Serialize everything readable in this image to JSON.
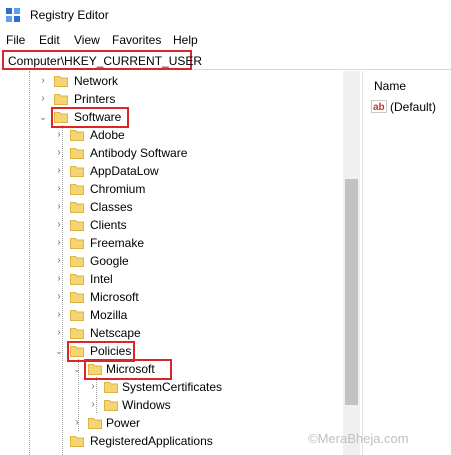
{
  "window": {
    "title": "Registry Editor"
  },
  "menu": [
    "File",
    "Edit",
    "View",
    "Favorites",
    "Help"
  ],
  "address": {
    "path": "Computer\\HKEY_CURRENT_USER"
  },
  "tree": {
    "items": [
      {
        "label": "Network",
        "toggle": "collapsed"
      },
      {
        "label": "Printers",
        "toggle": "collapsed"
      },
      {
        "label": "Software",
        "toggle": "expanded"
      },
      {
        "label": "Adobe",
        "toggle": "collapsed"
      },
      {
        "label": "Antibody Software",
        "toggle": "collapsed"
      },
      {
        "label": "AppDataLow",
        "toggle": "collapsed"
      },
      {
        "label": "Chromium",
        "toggle": "collapsed"
      },
      {
        "label": "Classes",
        "toggle": "collapsed"
      },
      {
        "label": "Clients",
        "toggle": "collapsed"
      },
      {
        "label": "Freemake",
        "toggle": "collapsed"
      },
      {
        "label": "Google",
        "toggle": "collapsed"
      },
      {
        "label": "Intel",
        "toggle": "collapsed"
      },
      {
        "label": "Microsoft",
        "toggle": "collapsed"
      },
      {
        "label": "Mozilla",
        "toggle": "collapsed"
      },
      {
        "label": "Netscape",
        "toggle": "collapsed"
      },
      {
        "label": "Policies",
        "toggle": "expanded"
      },
      {
        "label": "Microsoft",
        "toggle": "expanded",
        "selected": true
      },
      {
        "label": "SystemCertificates",
        "toggle": "collapsed"
      },
      {
        "label": "Windows",
        "toggle": "collapsed"
      },
      {
        "label": "Power",
        "toggle": "collapsed"
      },
      {
        "label": "RegisteredApplications",
        "toggle": "none"
      }
    ]
  },
  "values_pane": {
    "column_name": "Name",
    "rows": [
      {
        "name": "(Default)",
        "icon": "string-value-icon"
      }
    ]
  },
  "watermark": "©MeraBheja.com",
  "colors": {
    "highlight": "#d9262c",
    "folder": "#f5d475",
    "folder_edge": "#e0b440"
  }
}
